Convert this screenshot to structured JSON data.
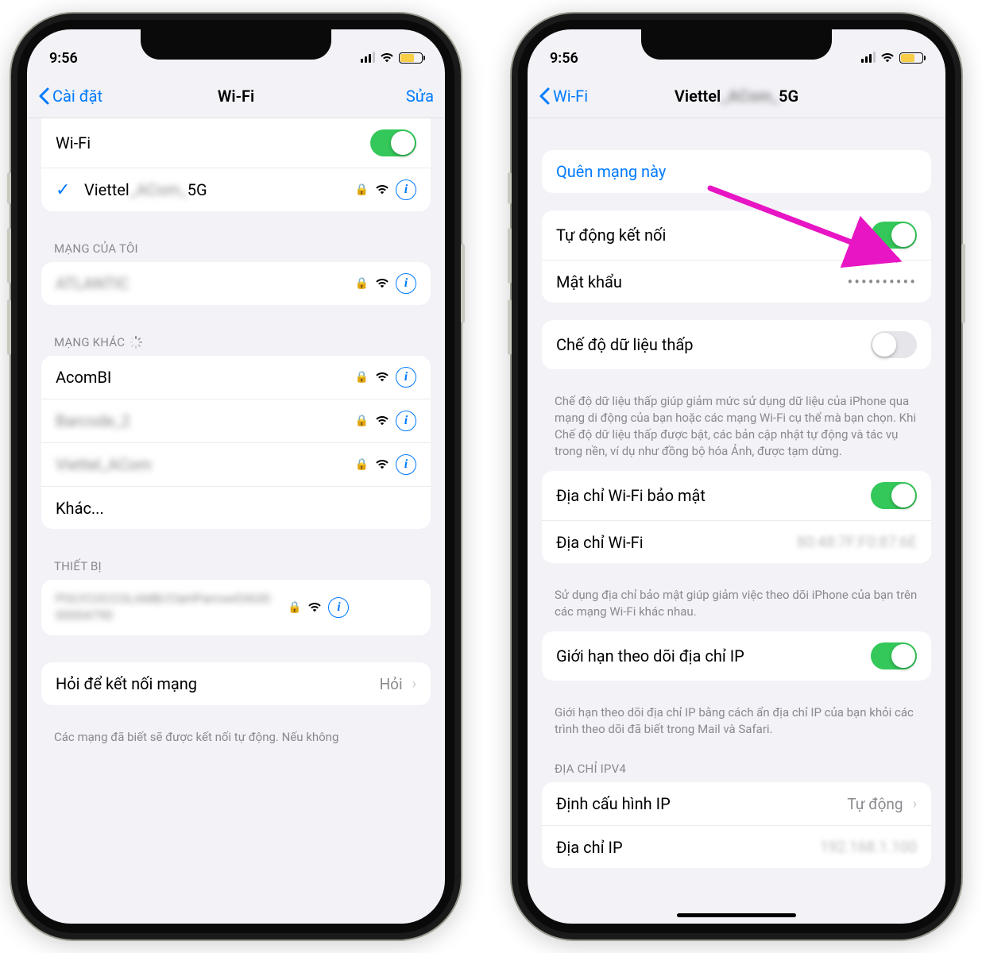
{
  "left": {
    "status": {
      "time": "9:56"
    },
    "nav": {
      "back": "Cài đặt",
      "title": "Wi-Fi",
      "edit": "Sửa"
    },
    "wifi_row": {
      "label": "Wi-Fi",
      "on": true
    },
    "connected": {
      "name_prefix": "Viettel",
      "name_suffix": "5G",
      "blurred": "_ACom_"
    },
    "my_networks": {
      "header": "MẠNG CỦA TÔI",
      "items": [
        "ATLANTIC"
      ]
    },
    "other_networks": {
      "header": "MẠNG KHÁC",
      "items": [
        "AcomBI",
        "Barcode_2",
        "Viettel_ACom"
      ],
      "other_label": "Khác..."
    },
    "devices": {
      "header": "THIẾT BỊ",
      "items": [
        "POLYCOCCOLAMB/ClaHParrow03630 00004790"
      ]
    },
    "ask": {
      "label": "Hỏi để kết nối mạng",
      "value": "Hỏi"
    },
    "footer": "Các mạng đã biết sẽ được kết nối tự động. Nếu không"
  },
  "right": {
    "status": {
      "time": "9:56"
    },
    "nav": {
      "back": "Wi-Fi",
      "title_prefix": "Viettel",
      "title_suffix": "5G",
      "title_blurred": "_ACom_"
    },
    "forget": "Quên mạng này",
    "auto_join": {
      "label": "Tự động kết nối",
      "on": true
    },
    "password": {
      "label": "Mật khẩu",
      "value": "••••••••••"
    },
    "low_data": {
      "label": "Chế độ dữ liệu thấp",
      "on": false,
      "footer": "Chế độ dữ liệu thấp giúp giảm mức sử dụng dữ liệu của iPhone qua mạng di động của bạn hoặc các mạng Wi-Fi cụ thể mà bạn chọn. Khi Chế độ dữ liệu thấp được bật, các bản cập nhật tự động và tác vụ trong nền, ví dụ như đồng bộ hóa Ảnh, được tạm dừng."
    },
    "private_addr": {
      "toggle_label": "Địa chỉ Wi-Fi bảo mật",
      "toggle_on": true,
      "addr_label": "Địa chỉ Wi-Fi",
      "addr_value": "80:48:7F:F0:87:6E",
      "footer": "Sử dụng địa chỉ bảo mật giúp giảm việc theo dõi iPhone của bạn trên các mạng Wi-Fi khác nhau."
    },
    "ip_tracking": {
      "label": "Giới hạn theo dõi địa chỉ IP",
      "on": true,
      "footer": "Giới hạn theo dõi địa chỉ IP bằng cách ẩn địa chỉ IP của bạn khỏi các trình theo dõi đã biết trong Mail và Safari."
    },
    "ipv4": {
      "header": "ĐỊA CHỈ IPV4",
      "configure_label": "Định cấu hình IP",
      "configure_value": "Tự động",
      "ip_label": "Địa chỉ IP"
    }
  }
}
